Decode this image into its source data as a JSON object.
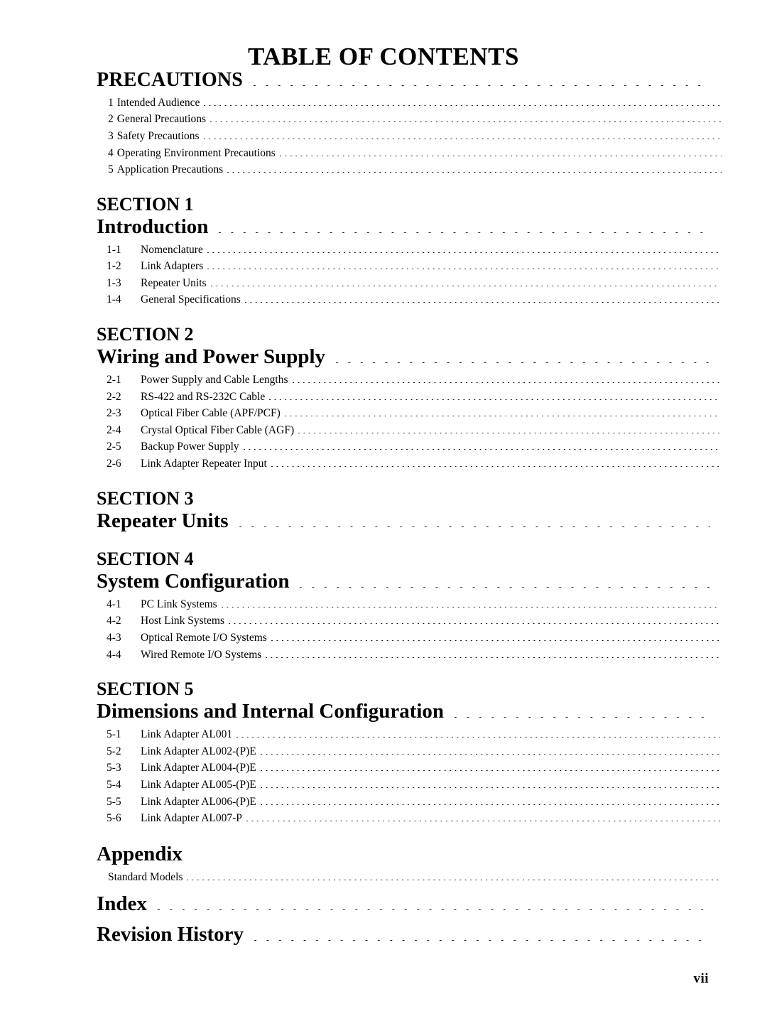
{
  "document": {
    "title": "TABLE OF CONTENTS",
    "page_number": "vii"
  },
  "entries": [
    {
      "kind": "heading_caps",
      "label": "PRECAUTIONS",
      "leader": true,
      "sub_style": "inline",
      "subs": [
        {
          "num": "1",
          "label": "Intended Audience"
        },
        {
          "num": "2",
          "label": "General Precautions"
        },
        {
          "num": "3",
          "label": "Safety Precautions"
        },
        {
          "num": "4",
          "label": "Operating Environment Precautions"
        },
        {
          "num": "5",
          "label": "Application Precautions"
        }
      ]
    },
    {
      "kind": "section",
      "section_label": "SECTION 1",
      "label": "Introduction",
      "leader": true,
      "sub_style": "numbered",
      "subs": [
        {
          "num": "1-1",
          "label": "Nomenclature"
        },
        {
          "num": "1-2",
          "label": "Link Adapters"
        },
        {
          "num": "1-3",
          "label": "Repeater Units"
        },
        {
          "num": "1-4",
          "label": "General Specifications"
        }
      ]
    },
    {
      "kind": "section",
      "section_label": "SECTION 2",
      "label": "Wiring and Power Supply",
      "leader": true,
      "sub_style": "numbered",
      "subs": [
        {
          "num": "2-1",
          "label": "Power Supply and Cable Lengths"
        },
        {
          "num": "2-2",
          "label": "RS-422 and RS-232C Cable"
        },
        {
          "num": "2-3",
          "label": "Optical Fiber Cable (APF/PCF)"
        },
        {
          "num": "2-4",
          "label": "Crystal Optical Fiber Cable (AGF)"
        },
        {
          "num": "2-5",
          "label": "Backup Power Supply"
        },
        {
          "num": "2-6",
          "label": "Link Adapter Repeater Input"
        }
      ]
    },
    {
      "kind": "section",
      "section_label": "SECTION 3",
      "label": "Repeater Units",
      "leader": true,
      "sub_style": "numbered",
      "subs": []
    },
    {
      "kind": "section",
      "section_label": "SECTION 4",
      "label": "System Configuration",
      "leader": true,
      "sub_style": "numbered",
      "subs": [
        {
          "num": "4-1",
          "label": "PC Link Systems"
        },
        {
          "num": "4-2",
          "label": "Host Link Systems"
        },
        {
          "num": "4-3",
          "label": "Optical Remote I/O Systems"
        },
        {
          "num": "4-4",
          "label": "Wired Remote I/O Systems"
        }
      ]
    },
    {
      "kind": "section",
      "section_label": "SECTION 5",
      "label": "Dimensions and Internal Configuration",
      "leader": true,
      "sub_style": "numbered",
      "subs": [
        {
          "num": "5-1",
          "label": "Link Adapter AL001"
        },
        {
          "num": "5-2",
          "label": "Link Adapter AL002-(P)E"
        },
        {
          "num": "5-3",
          "label": "Link Adapter AL004-(P)E"
        },
        {
          "num": "5-4",
          "label": "Link Adapter AL005-(P)E"
        },
        {
          "num": "5-5",
          "label": "Link Adapter AL006-(P)E"
        },
        {
          "num": "5-6",
          "label": "Link Adapter AL007-P"
        }
      ]
    },
    {
      "kind": "heading",
      "label": "Appendix",
      "leader": false,
      "sub_style": "plain",
      "subs": [
        {
          "num": "",
          "label": "Standard Models"
        }
      ]
    },
    {
      "kind": "heading",
      "label": "Index",
      "leader": true,
      "sub_style": "plain",
      "subs": []
    },
    {
      "kind": "heading",
      "label": "Revision History",
      "leader": true,
      "sub_style": "plain",
      "subs": []
    }
  ]
}
